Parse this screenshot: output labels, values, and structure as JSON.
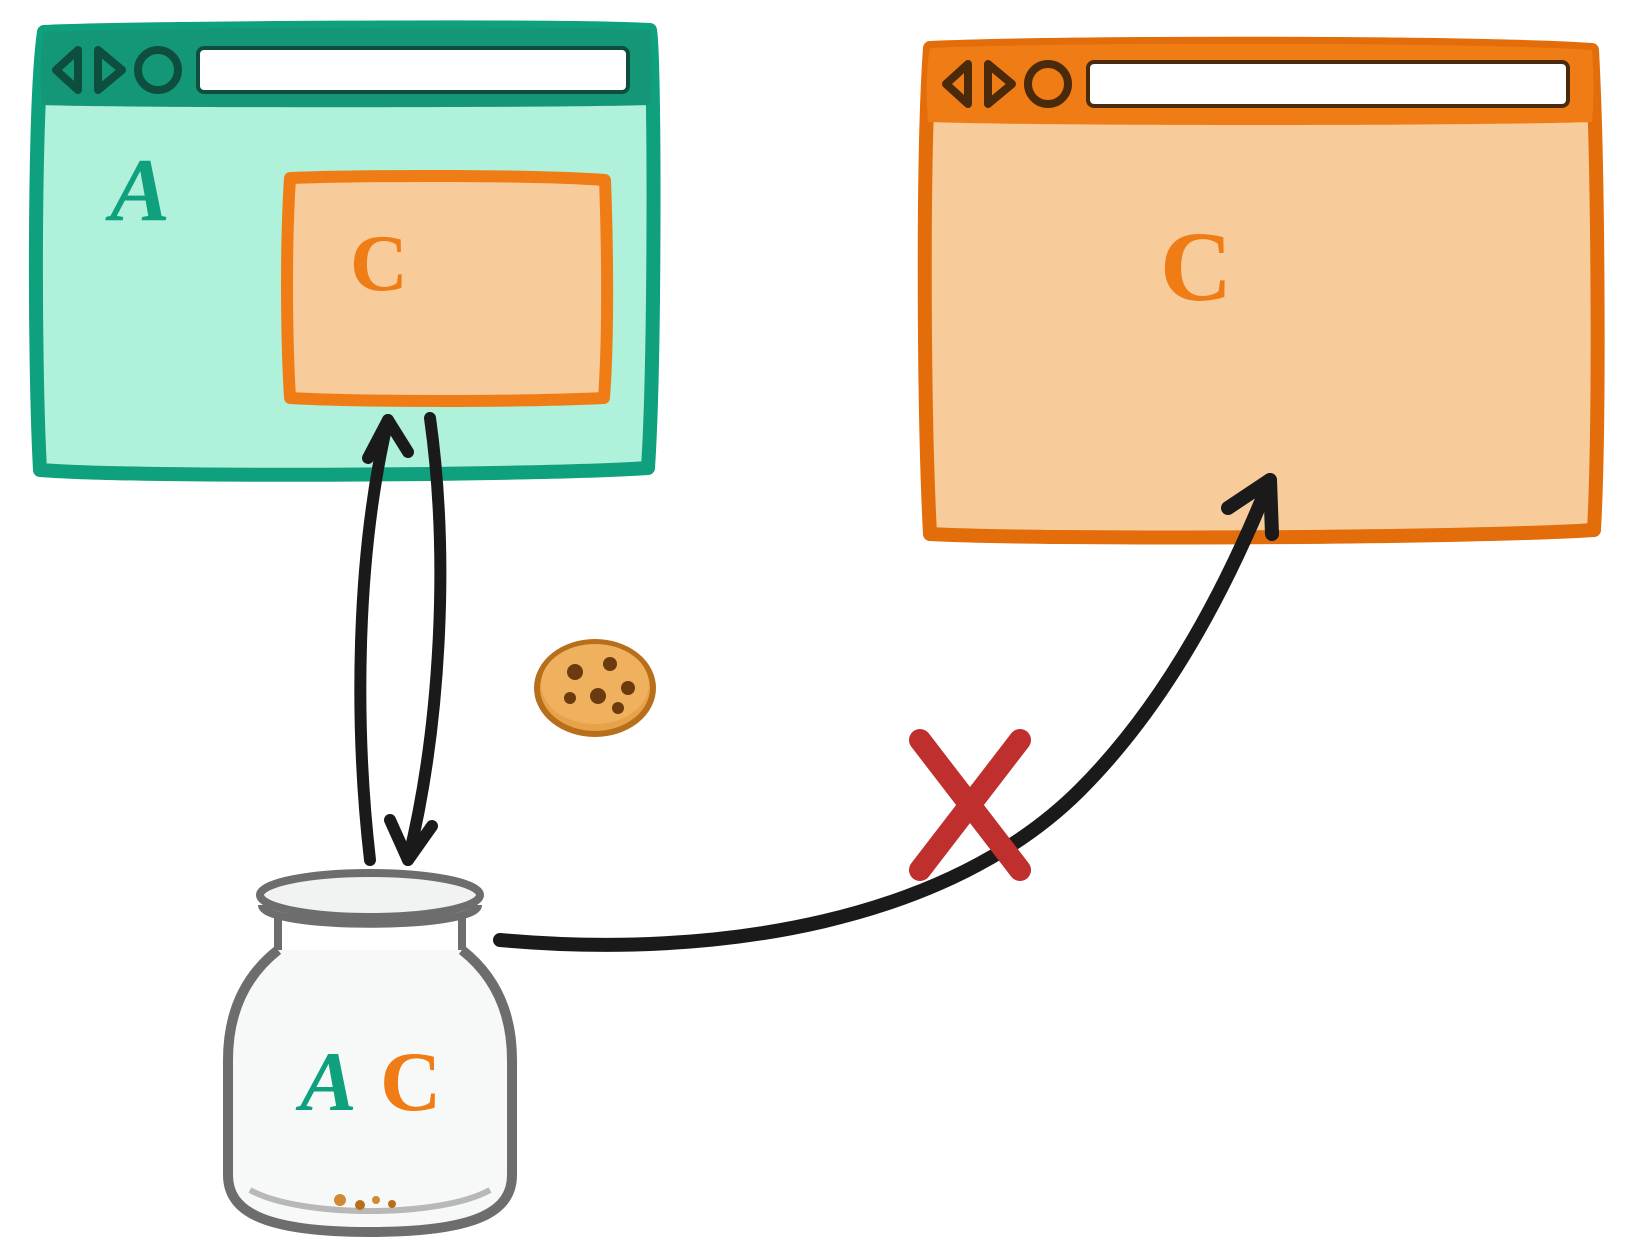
{
  "colors": {
    "green_dark": "#149777",
    "green_light": "#b0f1db",
    "green_border": "#0fa07d",
    "orange": "#f07c16",
    "orange_light": "#f7cb9a",
    "orange_dark": "#e36d0a",
    "black": "#1a1a1a",
    "red": "#be2f2e",
    "jar_gray": "#6d6d6d",
    "jar_fill": "#f1f3f2",
    "white": "#ffffff",
    "chip": "#8a4a14"
  },
  "browser_a": {
    "label": "A",
    "label_color": "#0fa07d",
    "iframe_label": "C",
    "iframe_label_color": "#f07c16"
  },
  "browser_c": {
    "label": "C",
    "label_color": "#f07c16"
  },
  "jar": {
    "label_left": "A",
    "label_left_color": "#0fa07d",
    "label_right": "C",
    "label_right_color": "#f07c16"
  },
  "blocked_marker": "X",
  "cookie_icon": "cookie"
}
